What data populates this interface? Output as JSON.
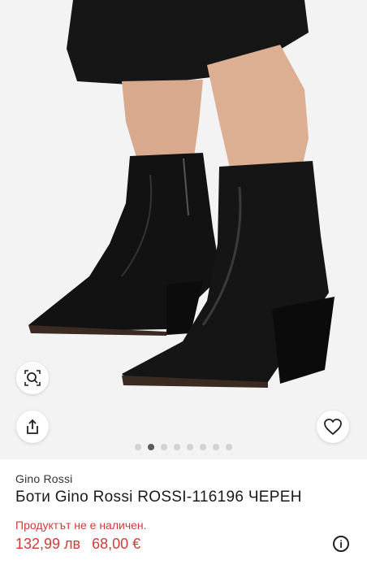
{
  "product": {
    "brand": "Gino Rossi",
    "title": "Боти Gino Rossi ROSSI-116196 ЧЕРЕН",
    "availability": "Продуктът не е наличен.",
    "old_price": "132,99 лв",
    "new_price": "68,00 €",
    "info_symbol": "i"
  },
  "gallery": {
    "dots_total": 8,
    "active_index": 1
  },
  "icons": {
    "zoom": "zoom-search-icon",
    "share": "share-icon",
    "favorite": "heart-icon",
    "info": "info-icon"
  },
  "colors": {
    "sale_red": "#d23a3a",
    "image_bg": "#f3f3f3",
    "active_dot": "#5a5a5a",
    "inactive_dot": "#d2d2d2"
  }
}
